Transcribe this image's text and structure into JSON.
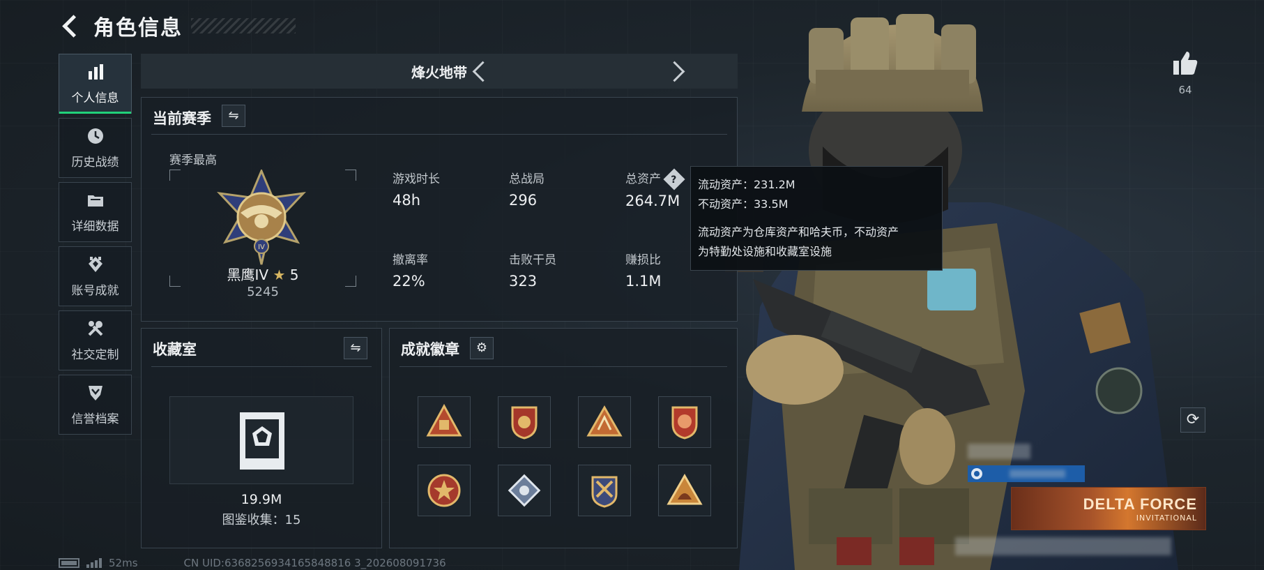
{
  "header": {
    "title": "角色信息"
  },
  "sidebar": {
    "items": [
      {
        "label": "个人信息",
        "icon": "bar-chart-icon",
        "active": true
      },
      {
        "label": "历史战绩",
        "icon": "history-icon",
        "active": false
      },
      {
        "label": "详细数据",
        "icon": "folder-icon",
        "active": false
      },
      {
        "label": "账号成就",
        "icon": "achievement-icon",
        "active": false
      },
      {
        "label": "社交定制",
        "icon": "tools-icon",
        "active": false
      },
      {
        "label": "信誉档案",
        "icon": "reputation-icon",
        "active": false
      }
    ]
  },
  "mode": {
    "label": "烽火地带"
  },
  "season": {
    "title": "当前赛季",
    "best_label": "赛季最高",
    "rank_name": "黑鹰IV",
    "rank_star": "★",
    "rank_stars": "5",
    "rank_score": "5245",
    "stats": [
      {
        "label": "游戏时长",
        "value": "48h"
      },
      {
        "label": "总战局",
        "value": "296"
      },
      {
        "label": "总资产",
        "value": "264.7M"
      },
      {
        "label": "撤离率",
        "value": "22%"
      },
      {
        "label": "击败干员",
        "value": "323"
      },
      {
        "label": "赚损比",
        "value": "1.1M"
      }
    ],
    "help_glyph": "?"
  },
  "tooltip": {
    "liquid": "流动资产：231.2M",
    "fixed": "不动资产：33.5M",
    "desc_1": "流动资产为仓库资产和哈夫币，不动资产",
    "desc_2": "为特勤处设施和收藏室设施"
  },
  "collection": {
    "title": "收藏室",
    "value": "19.9M",
    "count_label": "图鉴收集：15"
  },
  "badges": {
    "title": "成就徽章",
    "count": 8
  },
  "like": {
    "count": "64"
  },
  "banner": {
    "title": "DELTA FORCE",
    "subtitle": "INVITATIONAL"
  },
  "footer": {
    "ping": "52ms",
    "uid": "CN UID:6368256934165848816 3_202608091736"
  },
  "colors": {
    "accent": "#21d17a",
    "gold": "#d8b762",
    "panel_border": "#39444e"
  }
}
